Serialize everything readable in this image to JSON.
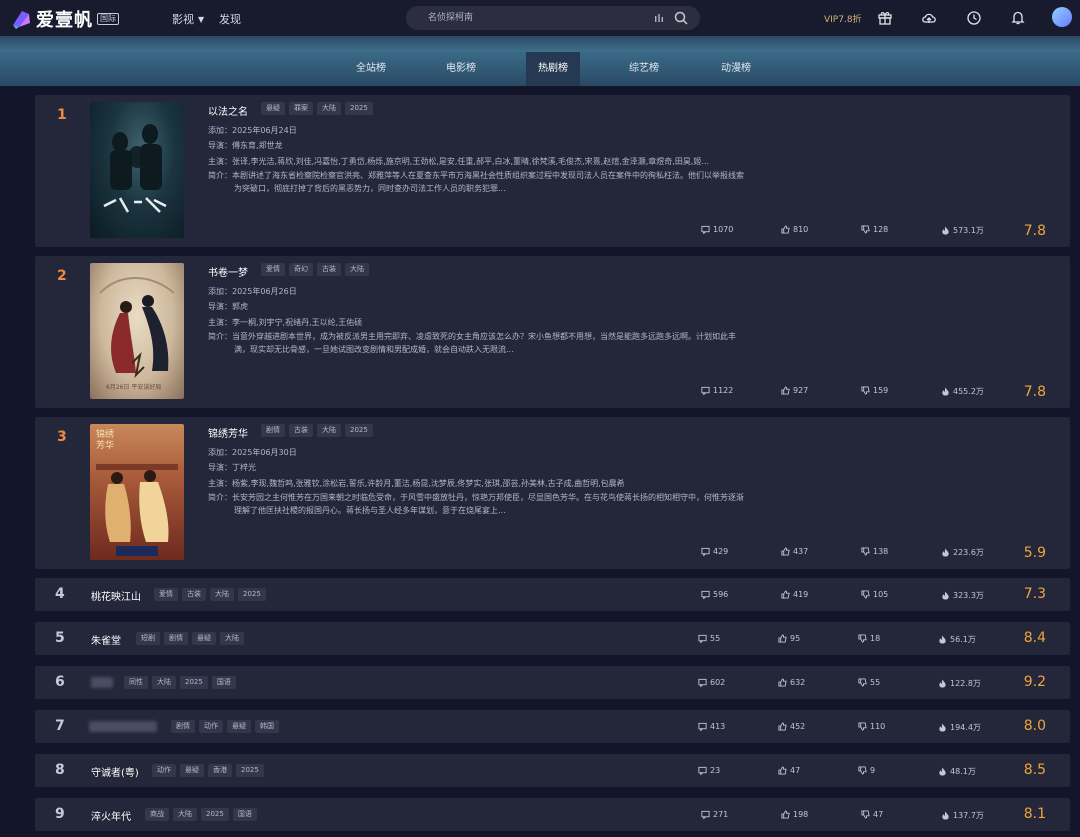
{
  "brand": {
    "name": "爱壹帆",
    "badge": "国际"
  },
  "nav": [
    {
      "label": "影视",
      "has_dropdown": true
    },
    {
      "label": "发现",
      "has_dropdown": false
    }
  ],
  "search": {
    "placeholder": "名侦探柯南"
  },
  "vip": "VIP7.8折",
  "icons": {
    "gift": "gift-icon",
    "upload": "cloud-upload-icon",
    "history": "history-icon",
    "bell": "bell-icon",
    "avatar": "avatar"
  },
  "colors": {
    "accent": "#f08a3c",
    "score": "#f0a43c",
    "vip": "#d6b27a",
    "card": "#24263a",
    "background": "#13152a"
  },
  "tabs": [
    {
      "label": "全站榜",
      "active": false
    },
    {
      "label": "电影榜",
      "active": false
    },
    {
      "label": "热剧榜",
      "active": true
    },
    {
      "label": "综艺榜",
      "active": false
    },
    {
      "label": "动漫榜",
      "active": false
    }
  ],
  "labels": {
    "date": "添加：",
    "director": "导演：",
    "cast": "主演：",
    "synopsis": "简介："
  },
  "items": [
    {
      "rank": "1",
      "title": "以法之名",
      "tags": [
        "悬疑",
        "罪案",
        "大陆",
        "2025"
      ],
      "date": "2025年06月24日",
      "director": "傅东育,郑世龙",
      "cast": "张译,李光洁,蒋欣,刘佳,冯嘉怡,丁勇岱,杨烁,施京明,王劲松,是安,任重,郝平,白冰,董晴,徐梵溪,毛俊杰,宋熹,赵煊,金泽灏,章煜奇,田昊,姬...",
      "synopsis": "本剧讲述了海东省检察院检察官洪亮、郑雅萍等人在夏查东平市万海黑社会性质组织案过程中发现司法人员在案件中的徇私枉法。他们以举报线索为突破口，彻底打掉了背后的黑恶势力，同时查办司法工作人员的职务犯罪...",
      "comments": "1070",
      "likes": "810",
      "dislikes": "128",
      "heat": "573.1万",
      "score": "7.8"
    },
    {
      "rank": "2",
      "title": "书卷一梦",
      "tags": [
        "爱情",
        "奇幻",
        "古装",
        "大陆"
      ],
      "date": "2025年06月26日",
      "director": "郭虎",
      "cast": "李一桐,刘宇宁,祝绪丹,王以纶,王佑硕",
      "synopsis": "当意外穿越进剧本世界，成为被反派男主用完即弃、凌虐致死的女主角应该怎么办？宋小鱼想都不用想，当然是能跑多远跑多远啊。计划如此丰满，现实却无比骨感，一旦她试图改变剧情和男配成婚，就会自动跌入无限流...",
      "poster_caption": "6月26日 平安该好局",
      "comments": "1122",
      "likes": "927",
      "dislikes": "159",
      "heat": "455.2万",
      "score": "7.8"
    },
    {
      "rank": "3",
      "title": "锦绣芳华",
      "tags": [
        "剧情",
        "古装",
        "大陆",
        "2025"
      ],
      "date": "2025年06月30日",
      "director": "丁梓光",
      "cast": "杨紫,李现,魏哲鸣,张雅钦,涂松岩,誓乐,许龄月,董洁,杨昆,沈梦辰,佟梦实,张琪,邵芸,孙美林,古子成,曲哲明,包晨希",
      "synopsis": "长安芳园之主何惟芳在万国来朝之时临危受命，于风雪中盛放牡丹，惊艳万邦使臣，尽显国色芳华。在与花鸟使蒋长扬的相知相守中，何惟芳逐渐理解了他匡扶社稷的报国丹心。蒋长扬与圣人经多年谋划，意于在烧尾宴上...",
      "poster_title": "锦绣芳华",
      "comments": "429",
      "likes": "437",
      "dislikes": "138",
      "heat": "223.6万",
      "score": "5.9"
    },
    {
      "rank": "4",
      "title": "桃花映江山",
      "tags": [
        "爱情",
        "古装",
        "大陆",
        "2025"
      ],
      "comments": "596",
      "likes": "419",
      "dislikes": "105",
      "heat": "323.3万",
      "score": "7.3"
    },
    {
      "rank": "5",
      "title": "朱雀堂",
      "tags": [
        "短剧",
        "剧情",
        "悬疑",
        "大陆"
      ],
      "comments": "55",
      "likes": "95",
      "dislikes": "18",
      "heat": "56.1万",
      "score": "8.4"
    },
    {
      "rank": "6",
      "title": "",
      "tags": [
        "同性",
        "大陆",
        "2025",
        "国语"
      ],
      "comments": "602",
      "likes": "632",
      "dislikes": "55",
      "heat": "122.8万",
      "score": "9.2"
    },
    {
      "rank": "7",
      "title": "",
      "tags": [
        "剧情",
        "动作",
        "悬疑",
        "韩国"
      ],
      "comments": "413",
      "likes": "452",
      "dislikes": "110",
      "heat": "194.4万",
      "score": "8.0"
    },
    {
      "rank": "8",
      "title": "守诚者(粤)",
      "tags": [
        "动作",
        "悬疑",
        "香港",
        "2025"
      ],
      "comments": "23",
      "likes": "47",
      "dislikes": "9",
      "heat": "48.1万",
      "score": "8.5"
    },
    {
      "rank": "9",
      "title": "淬火年代",
      "tags": [
        "商战",
        "大陆",
        "2025",
        "国语"
      ],
      "comments": "271",
      "likes": "198",
      "dislikes": "47",
      "heat": "137.7万",
      "score": "8.1"
    }
  ]
}
